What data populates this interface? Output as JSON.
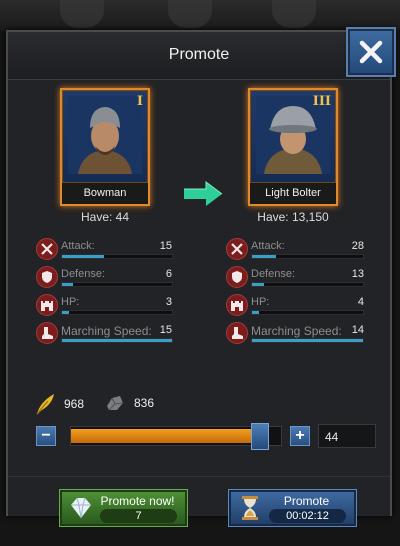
{
  "dialog": {
    "title": "Promote"
  },
  "from_unit": {
    "name": "Bowman",
    "tier": "I",
    "have_text": "Have: 44"
  },
  "to_unit": {
    "name": "Light Bolter",
    "tier": "III",
    "have_text": "Have: 13,150"
  },
  "from_stats": [
    {
      "label": "Attack:",
      "value": "15",
      "icon": "crossed-swords-icon",
      "fill": 0.38
    },
    {
      "label": "Defense:",
      "value": "6",
      "icon": "shield-icon",
      "fill": 0.1
    },
    {
      "label": "HP:",
      "value": "3",
      "icon": "castle-icon",
      "fill": 0.06
    },
    {
      "label": "Marching Speed:",
      "value": "15",
      "icon": "boot-icon",
      "fill": 1.0
    }
  ],
  "to_stats": [
    {
      "label": "Attack:",
      "value": "28",
      "icon": "crossed-swords-icon",
      "fill": 0.22
    },
    {
      "label": "Defense:",
      "value": "13",
      "icon": "shield-icon",
      "fill": 0.11
    },
    {
      "label": "HP:",
      "value": "4",
      "icon": "castle-icon",
      "fill": 0.06
    },
    {
      "label": "Marching Speed:",
      "value": "14",
      "icon": "boot-icon",
      "fill": 1.0
    }
  ],
  "resources": {
    "feather": "968",
    "metal": "836"
  },
  "quantity": {
    "value": "44",
    "fill": 0.9
  },
  "buttons": {
    "promote_now_label": "Promote now!",
    "promote_now_cost": "7",
    "promote_label": "Promote",
    "promote_time": "00:02:12"
  },
  "colors": {
    "accent_orange": "#e08a2a",
    "stat_bar": "#3a9fc4",
    "green_button": "#4d8f35",
    "blue_button": "#3e6aa0"
  }
}
